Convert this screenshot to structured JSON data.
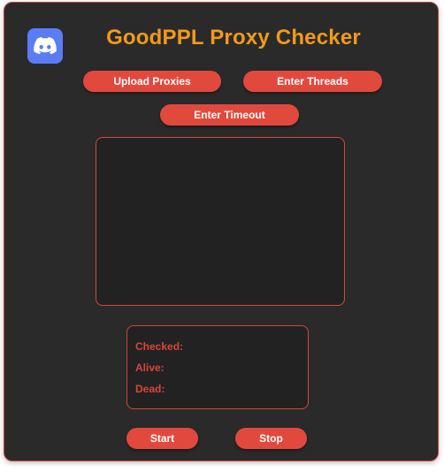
{
  "app": {
    "title": "GoodPPL Proxy Checker",
    "logo_icon": "discord-icon"
  },
  "controls": {
    "upload_label": "Upload Proxies",
    "threads_label": "Enter Threads",
    "timeout_label": "Enter Timeout",
    "start_label": "Start",
    "stop_label": "Stop"
  },
  "output": {
    "value": ""
  },
  "stats": {
    "checked_label": "Checked:",
    "alive_label": "Alive:",
    "dead_label": "Dead:"
  },
  "colors": {
    "background": "#2a2a2a",
    "accent": "#e2493d",
    "title": "#f29a18",
    "logo": "#5b7cf7"
  }
}
